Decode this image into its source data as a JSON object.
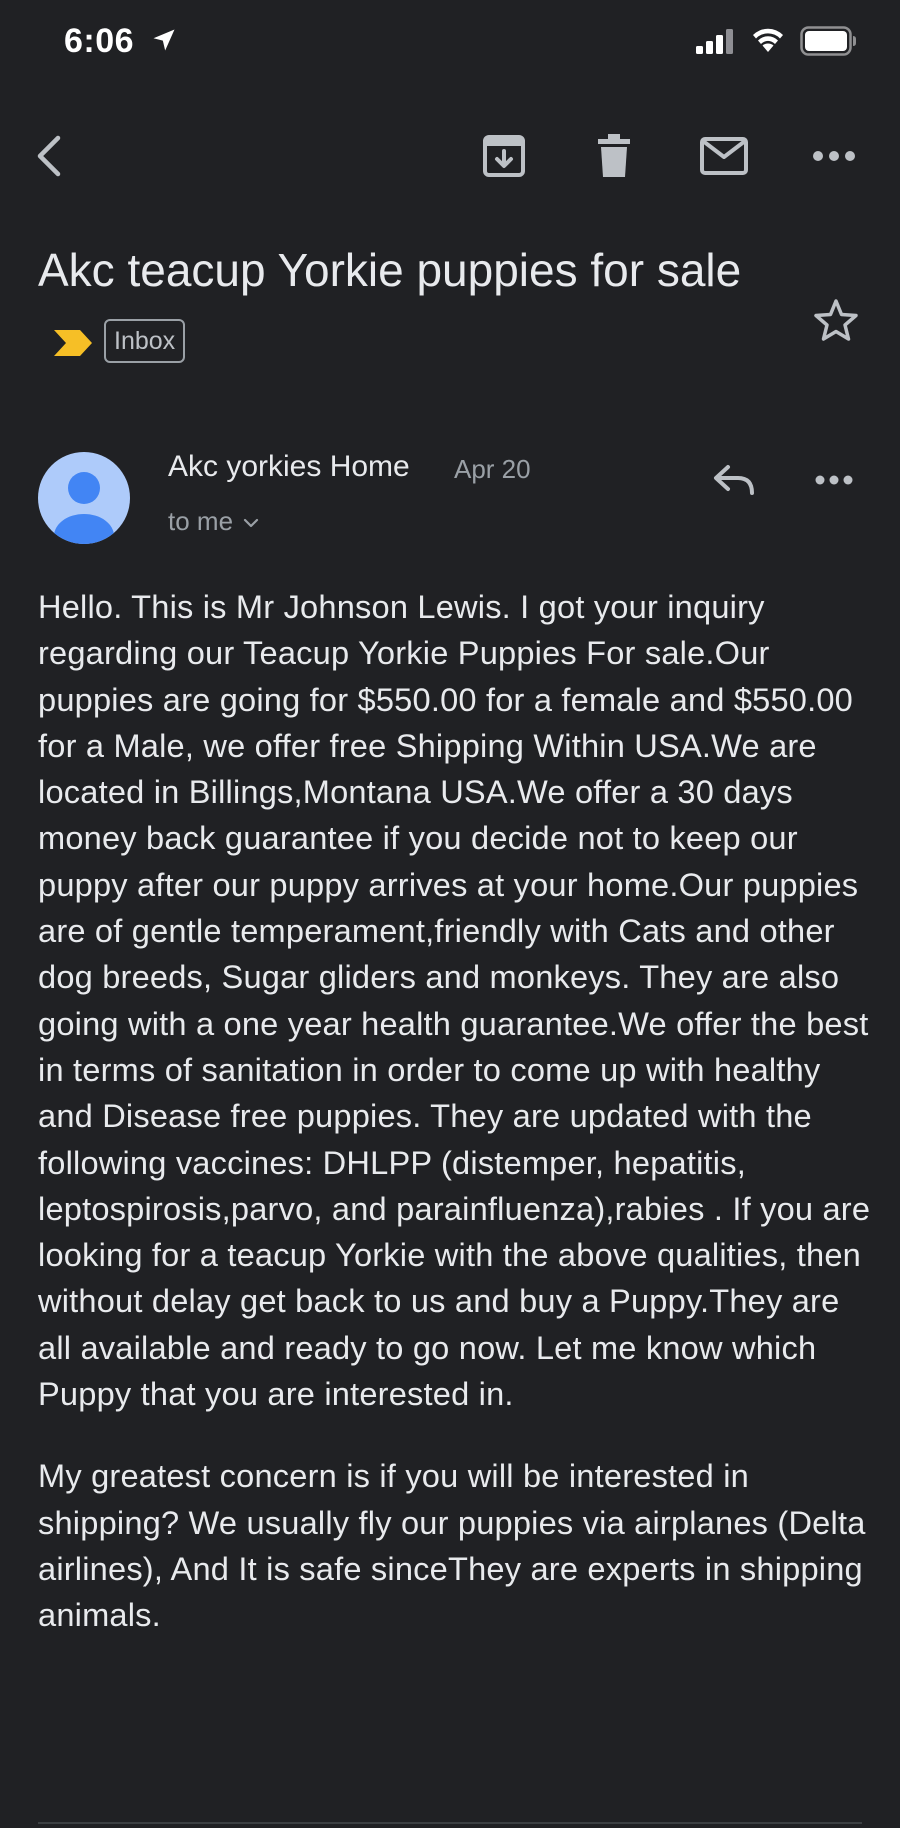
{
  "status_bar": {
    "time": "6:06"
  },
  "toolbar": {
    "back": "back-arrow-icon",
    "archive": "archive-icon",
    "delete": "trash-icon",
    "mark_unread": "mail-icon",
    "more": "more-horizontal-icon"
  },
  "email": {
    "subject": "Akc teacup Yorkie puppies for sale",
    "label": "Inbox",
    "sender_name": "Akc yorkies Home",
    "date": "Apr 20",
    "recipient": "to me",
    "body_paragraph_1": "Hello. This is Mr Johnson Lewis. I got your inquiry regarding our Teacup Yorkie Puppies For sale.Our puppies are going for $550.00 for a female and $550.00 for a Male, we offer free Shipping Within USA.We are located in Billings,Montana USA.We offer a 30 days money back guarantee if you decide not to keep our puppy after our puppy arrives at your home.Our puppies are of gentle temperament,friendly with Cats and other dog breeds, Sugar gliders and monkeys. They are also going with a one year health guarantee.We offer the best in terms of sanitation in order to come up with healthy and Disease free puppies. They are updated with the following vaccines: DHLPP (distemper, hepatitis, leptospirosis,parvo, and parainfluenza),rabies . If you are looking for a teacup Yorkie with the above qualities, then without delay get back to us and buy a Puppy.They are all available and ready to go now. Let me know which Puppy that you are interested in.",
    "body_paragraph_2": "My greatest concern is if you will be interested in shipping? We usually fly our puppies via airplanes (Delta airlines), And It is safe sinceThey are experts in shipping animals."
  },
  "colors": {
    "background": "#202124",
    "text": "#e8eaed",
    "secondary_text": "#9aa0a6",
    "icon": "#bdc1c6",
    "importance_marker": "#f6bf26",
    "avatar_bg": "#aecbfa",
    "avatar_fg": "#4285f4"
  }
}
